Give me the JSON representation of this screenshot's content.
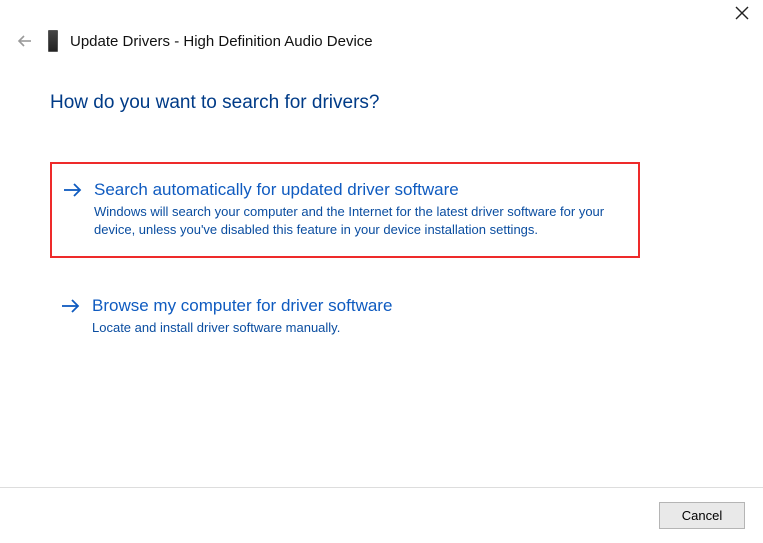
{
  "window": {
    "title": "Update Drivers - High Definition Audio Device"
  },
  "question": "How do you want to search for drivers?",
  "options": [
    {
      "title": "Search automatically for updated driver software",
      "description": "Windows will search your computer and the Internet for the latest driver software for your device, unless you've disabled this feature in your device installation settings."
    },
    {
      "title": "Browse my computer for driver software",
      "description": "Locate and install driver software manually."
    }
  ],
  "buttons": {
    "cancel": "Cancel"
  }
}
